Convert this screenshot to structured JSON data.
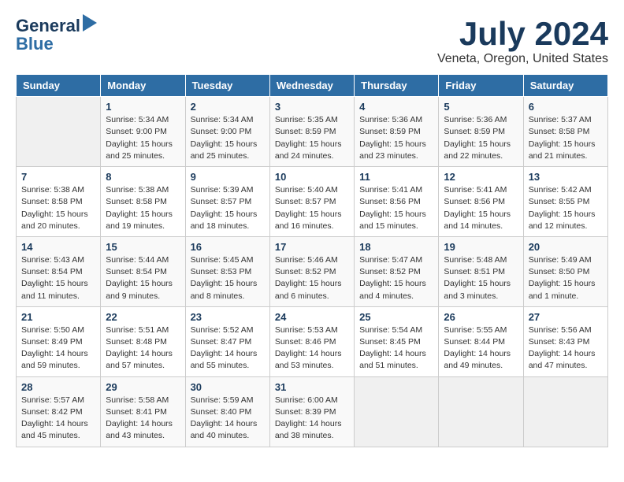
{
  "header": {
    "logo_general": "General",
    "logo_blue": "Blue",
    "month_year": "July 2024",
    "location": "Veneta, Oregon, United States"
  },
  "days_of_week": [
    "Sunday",
    "Monday",
    "Tuesday",
    "Wednesday",
    "Thursday",
    "Friday",
    "Saturday"
  ],
  "weeks": [
    [
      {
        "day": "",
        "info": ""
      },
      {
        "day": "1",
        "info": "Sunrise: 5:34 AM\nSunset: 9:00 PM\nDaylight: 15 hours\nand 25 minutes."
      },
      {
        "day": "2",
        "info": "Sunrise: 5:34 AM\nSunset: 9:00 PM\nDaylight: 15 hours\nand 25 minutes."
      },
      {
        "day": "3",
        "info": "Sunrise: 5:35 AM\nSunset: 8:59 PM\nDaylight: 15 hours\nand 24 minutes."
      },
      {
        "day": "4",
        "info": "Sunrise: 5:36 AM\nSunset: 8:59 PM\nDaylight: 15 hours\nand 23 minutes."
      },
      {
        "day": "5",
        "info": "Sunrise: 5:36 AM\nSunset: 8:59 PM\nDaylight: 15 hours\nand 22 minutes."
      },
      {
        "day": "6",
        "info": "Sunrise: 5:37 AM\nSunset: 8:58 PM\nDaylight: 15 hours\nand 21 minutes."
      }
    ],
    [
      {
        "day": "7",
        "info": "Sunrise: 5:38 AM\nSunset: 8:58 PM\nDaylight: 15 hours\nand 20 minutes."
      },
      {
        "day": "8",
        "info": "Sunrise: 5:38 AM\nSunset: 8:58 PM\nDaylight: 15 hours\nand 19 minutes."
      },
      {
        "day": "9",
        "info": "Sunrise: 5:39 AM\nSunset: 8:57 PM\nDaylight: 15 hours\nand 18 minutes."
      },
      {
        "day": "10",
        "info": "Sunrise: 5:40 AM\nSunset: 8:57 PM\nDaylight: 15 hours\nand 16 minutes."
      },
      {
        "day": "11",
        "info": "Sunrise: 5:41 AM\nSunset: 8:56 PM\nDaylight: 15 hours\nand 15 minutes."
      },
      {
        "day": "12",
        "info": "Sunrise: 5:41 AM\nSunset: 8:56 PM\nDaylight: 15 hours\nand 14 minutes."
      },
      {
        "day": "13",
        "info": "Sunrise: 5:42 AM\nSunset: 8:55 PM\nDaylight: 15 hours\nand 12 minutes."
      }
    ],
    [
      {
        "day": "14",
        "info": "Sunrise: 5:43 AM\nSunset: 8:54 PM\nDaylight: 15 hours\nand 11 minutes."
      },
      {
        "day": "15",
        "info": "Sunrise: 5:44 AM\nSunset: 8:54 PM\nDaylight: 15 hours\nand 9 minutes."
      },
      {
        "day": "16",
        "info": "Sunrise: 5:45 AM\nSunset: 8:53 PM\nDaylight: 15 hours\nand 8 minutes."
      },
      {
        "day": "17",
        "info": "Sunrise: 5:46 AM\nSunset: 8:52 PM\nDaylight: 15 hours\nand 6 minutes."
      },
      {
        "day": "18",
        "info": "Sunrise: 5:47 AM\nSunset: 8:52 PM\nDaylight: 15 hours\nand 4 minutes."
      },
      {
        "day": "19",
        "info": "Sunrise: 5:48 AM\nSunset: 8:51 PM\nDaylight: 15 hours\nand 3 minutes."
      },
      {
        "day": "20",
        "info": "Sunrise: 5:49 AM\nSunset: 8:50 PM\nDaylight: 15 hours\nand 1 minute."
      }
    ],
    [
      {
        "day": "21",
        "info": "Sunrise: 5:50 AM\nSunset: 8:49 PM\nDaylight: 14 hours\nand 59 minutes."
      },
      {
        "day": "22",
        "info": "Sunrise: 5:51 AM\nSunset: 8:48 PM\nDaylight: 14 hours\nand 57 minutes."
      },
      {
        "day": "23",
        "info": "Sunrise: 5:52 AM\nSunset: 8:47 PM\nDaylight: 14 hours\nand 55 minutes."
      },
      {
        "day": "24",
        "info": "Sunrise: 5:53 AM\nSunset: 8:46 PM\nDaylight: 14 hours\nand 53 minutes."
      },
      {
        "day": "25",
        "info": "Sunrise: 5:54 AM\nSunset: 8:45 PM\nDaylight: 14 hours\nand 51 minutes."
      },
      {
        "day": "26",
        "info": "Sunrise: 5:55 AM\nSunset: 8:44 PM\nDaylight: 14 hours\nand 49 minutes."
      },
      {
        "day": "27",
        "info": "Sunrise: 5:56 AM\nSunset: 8:43 PM\nDaylight: 14 hours\nand 47 minutes."
      }
    ],
    [
      {
        "day": "28",
        "info": "Sunrise: 5:57 AM\nSunset: 8:42 PM\nDaylight: 14 hours\nand 45 minutes."
      },
      {
        "day": "29",
        "info": "Sunrise: 5:58 AM\nSunset: 8:41 PM\nDaylight: 14 hours\nand 43 minutes."
      },
      {
        "day": "30",
        "info": "Sunrise: 5:59 AM\nSunset: 8:40 PM\nDaylight: 14 hours\nand 40 minutes."
      },
      {
        "day": "31",
        "info": "Sunrise: 6:00 AM\nSunset: 8:39 PM\nDaylight: 14 hours\nand 38 minutes."
      },
      {
        "day": "",
        "info": ""
      },
      {
        "day": "",
        "info": ""
      },
      {
        "day": "",
        "info": ""
      }
    ]
  ]
}
